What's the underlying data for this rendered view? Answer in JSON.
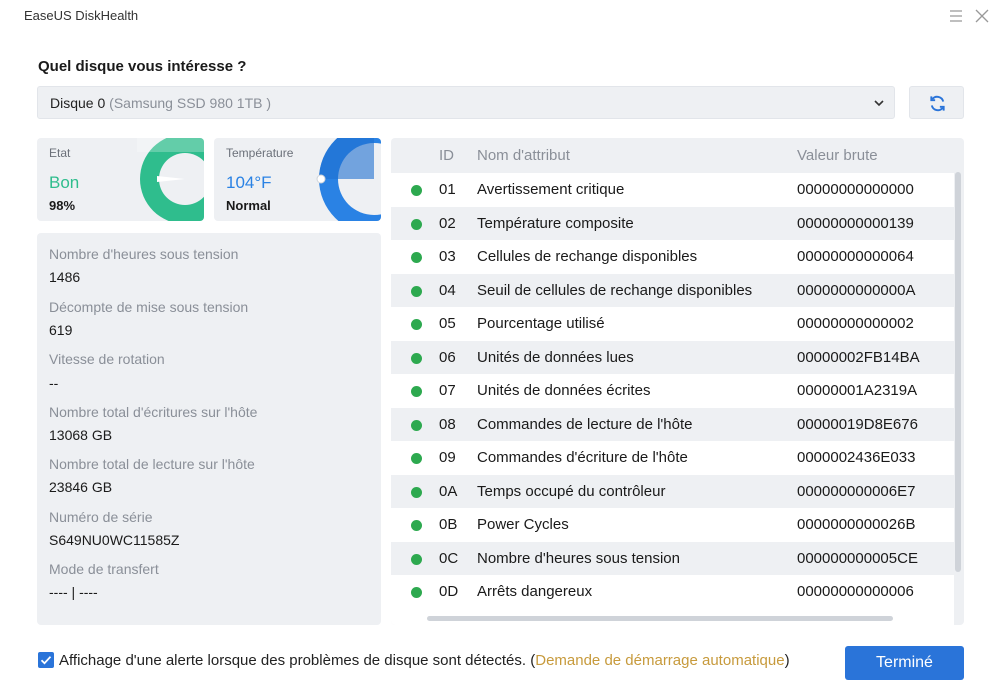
{
  "app": {
    "title": "EaseUS DiskHealth"
  },
  "question": "Quel disque vous intéresse ?",
  "disk_select": {
    "name": "Disque 0",
    "model_prefix": "(",
    "model": "Samsung SSD 980 1TB",
    "model_suffix": ")"
  },
  "cards": {
    "state": {
      "title": "Etat",
      "value": "Bon",
      "sub": "98%",
      "level": 0.98
    },
    "temperature": {
      "title": "Température",
      "value": "104°F",
      "sub": "Normal"
    }
  },
  "info": [
    {
      "label": "Nombre d'heures sous tension",
      "value": "1486"
    },
    {
      "label": "Décompte de mise sous tension",
      "value": "619"
    },
    {
      "label": "Vitesse de rotation",
      "value": "--"
    },
    {
      "label": "Nombre total d'écritures sur l'hôte",
      "value": "13068 GB"
    },
    {
      "label": "Nombre total de lecture sur l'hôte",
      "value": "23846 GB"
    },
    {
      "label": "Numéro de série",
      "value": "S649NU0WC11585Z"
    },
    {
      "label": "Mode de transfert",
      "value": "---- | ----"
    }
  ],
  "table": {
    "headers": {
      "id": "ID",
      "name": "Nom d'attribut",
      "raw": "Valeur brute"
    },
    "rows": [
      {
        "id": "01",
        "name": "Avertissement critique",
        "raw": "00000000000000"
      },
      {
        "id": "02",
        "name": "Température composite",
        "raw": "00000000000139"
      },
      {
        "id": "03",
        "name": "Cellules de rechange disponibles",
        "raw": "00000000000064"
      },
      {
        "id": "04",
        "name": "Seuil de cellules de rechange disponibles",
        "raw": "0000000000000A"
      },
      {
        "id": "05",
        "name": "Pourcentage utilisé",
        "raw": "00000000000002"
      },
      {
        "id": "06",
        "name": "Unités de données lues",
        "raw": "00000002FB14BA"
      },
      {
        "id": "07",
        "name": "Unités de données écrites",
        "raw": "00000001A2319A"
      },
      {
        "id": "08",
        "name": "Commandes de lecture de l'hôte",
        "raw": "00000019D8E676"
      },
      {
        "id": "09",
        "name": "Commandes d'écriture de l'hôte",
        "raw": "0000002436E033"
      },
      {
        "id": "0A",
        "name": "Temps occupé du contrôleur",
        "raw": "000000000006E7"
      },
      {
        "id": "0B",
        "name": "Power Cycles",
        "raw": "0000000000026B"
      },
      {
        "id": "0C",
        "name": "Nombre d'heures sous tension",
        "raw": "000000000005CE"
      },
      {
        "id": "0D",
        "name": "Arrêts dangereux",
        "raw": "00000000000006"
      }
    ],
    "status_color": "#2da94f"
  },
  "alert": {
    "checked": true,
    "text": "Affichage d'une alerte lorsque des problèmes de disque sont détectés. (",
    "link": "Demande de démarrage automatique",
    "suffix": ")"
  },
  "done_button": "Terminé",
  "colors": {
    "accent": "#2a74d9",
    "good": "#2fbd8d",
    "temp": "#2a82e4",
    "link": "#c79a3c"
  }
}
